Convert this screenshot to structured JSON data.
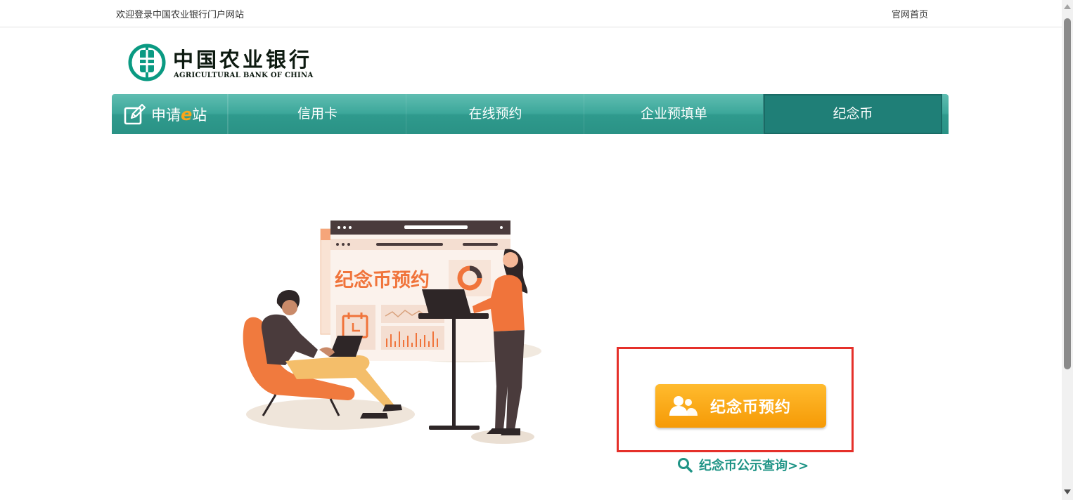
{
  "topbar": {
    "welcome": "欢迎登录中国农业银行门户网站",
    "home_link": "官网首页"
  },
  "logo": {
    "name_cn": "中国农业银行",
    "name_en": "AGRICULTURAL BANK OF CHINA"
  },
  "nav": {
    "brand_prefix": "申请",
    "brand_e": "e",
    "brand_suffix": "站",
    "tabs": [
      {
        "label": "信用卡"
      },
      {
        "label": "在线预约"
      },
      {
        "label": "企业预填单"
      },
      {
        "label": "纪念币",
        "active": true
      }
    ]
  },
  "illustration": {
    "title": "纪念币预约"
  },
  "main": {
    "reserve_button": "纪念币预约",
    "query_link": "纪念币公示查询>>"
  },
  "colors": {
    "nav_teal": "#3ca79a",
    "active_tab": "#1f7f77",
    "button_orange": "#f69a06",
    "highlight_red": "#e5302a",
    "link_teal": "#1f9486"
  },
  "icons": [
    "abc-logo-icon",
    "edit-form-icon",
    "users-icon",
    "search-icon"
  ]
}
